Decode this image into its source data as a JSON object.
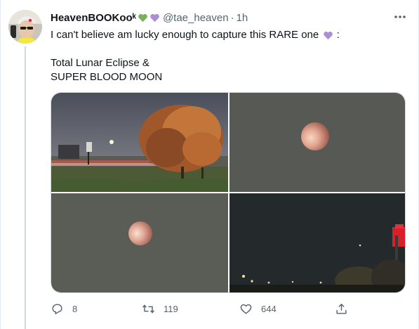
{
  "user": {
    "display_name": "HeavenBOOKoo",
    "display_name_suffix": "ᵏ",
    "handle": "@tae_heaven",
    "separator": "·",
    "time": "1h",
    "heart_colors": [
      "#78b159",
      "#aa8ed6"
    ]
  },
  "tweet": {
    "line1": "I can't believe am lucky enough to capture this RARE one",
    "line1_suffix": ":",
    "line2": "Total Lunar Eclipse &",
    "line3": "SUPER BLOOD MOON",
    "emoji_heart_color": "#aa8ed6"
  },
  "media": {
    "images": [
      {
        "name": "landscape-with-tree-photo"
      },
      {
        "name": "eclipsed-moon-photo-1"
      },
      {
        "name": "eclipsed-moon-photo-2"
      },
      {
        "name": "night-sky-with-streetlight-photo"
      }
    ]
  },
  "actions": {
    "reply": {
      "icon": "reply-icon",
      "count": "8"
    },
    "retweet": {
      "icon": "retweet-icon",
      "count": "119"
    },
    "like": {
      "icon": "heart-icon",
      "count": "644"
    },
    "share": {
      "icon": "share-icon"
    }
  },
  "colors": {
    "text_primary": "#0f1419",
    "text_secondary": "#536471",
    "border": "#cfd9de"
  }
}
